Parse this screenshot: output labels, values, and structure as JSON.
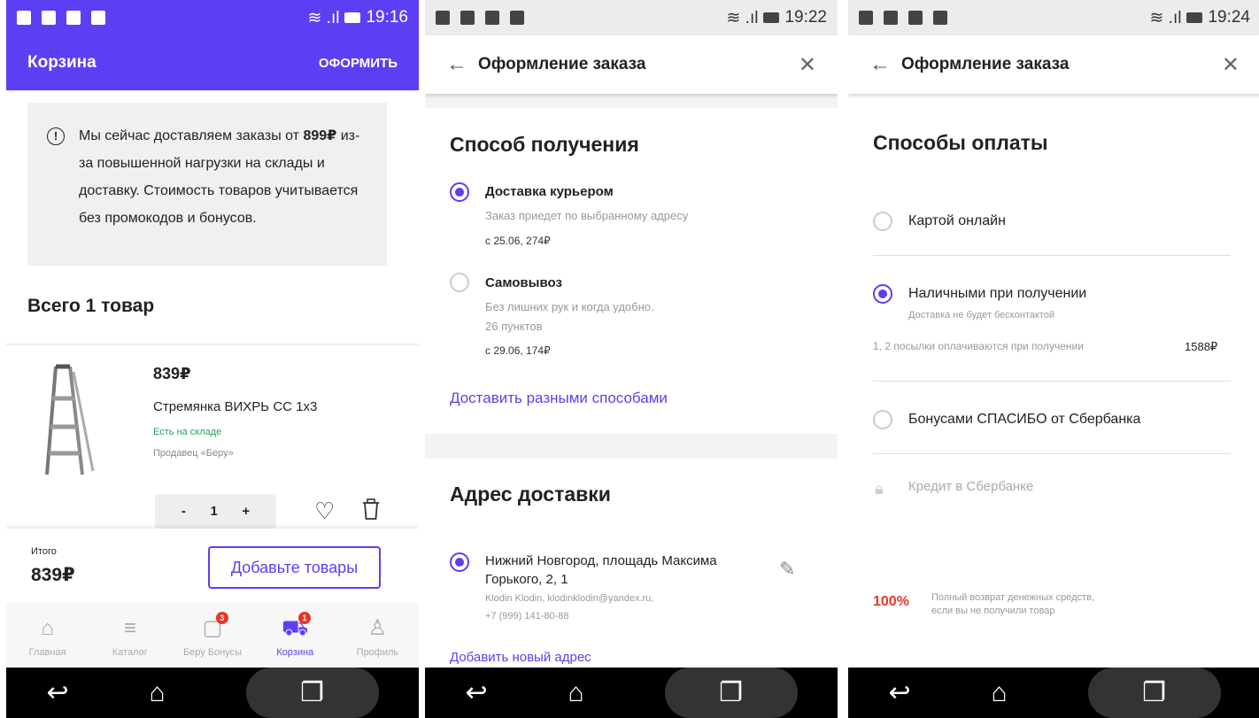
{
  "status_bars": [
    {
      "time": "19:16"
    },
    {
      "time": "19:22"
    },
    {
      "time": "19:24"
    }
  ],
  "cart": {
    "title": "Корзина",
    "action": "ОФОРМИТЬ",
    "notice_pre": "Мы сейчас доставляем заказы от ",
    "notice_bold": "899₽",
    "notice_post": " из-за повышенной нагрузки на склады и доставку. Стоимость товаров учитывается без промокодов и бонусов.",
    "count_title": "Всего 1 товар",
    "product": {
      "price": "839₽",
      "name": "Стремянка ВИХРЬ СС 1х3",
      "stock": "Есть на складе",
      "seller": "Продавец «Беру»",
      "qty_minus": "-",
      "qty": "1",
      "qty_plus": "+"
    },
    "total_label": "Итого",
    "total_sum": "839₽",
    "add_button": "Добавьте товары",
    "nav": [
      {
        "label": "Главная",
        "icon": "home-icon",
        "glyph": "⌂"
      },
      {
        "label": "Каталог",
        "icon": "catalog-search-icon",
        "glyph": "≡"
      },
      {
        "label": "Беру Бонусы",
        "icon": "bonus-gift-icon",
        "glyph": "▢",
        "badge": "3"
      },
      {
        "label": "Корзина",
        "icon": "cart-icon",
        "glyph": "⛟",
        "badge": "1",
        "active": true
      },
      {
        "label": "Профиль",
        "icon": "profile-icon",
        "glyph": "♙"
      }
    ]
  },
  "delivery": {
    "header_title": "Оформление заказа",
    "section_title": "Способ получения",
    "courier": {
      "title": "Доставка курьером",
      "desc": "Заказ приедет по выбранному адресу",
      "date": "с 25.06, 274₽"
    },
    "pickup": {
      "title": "Самовывоз",
      "desc1": "Без лишних рук и когда удобно.",
      "desc2": "26 пунктов",
      "date": "с 29.06, 174₽"
    },
    "split_link": "Доставить разными способами",
    "address_title": "Адрес доставки",
    "address_line1": "Нижний Новгород, площадь Максима",
    "address_line2": "Горького, 2, 1",
    "contact1": "Klodin Klodin, klodinklodin@yandex.ru,",
    "contact2": "+7 (999) 141-80-88",
    "add_address": "Добавить новый адрес"
  },
  "payment": {
    "header_title": "Оформление заказа",
    "section_title": "Способы оплаты",
    "card": "Картой онлайн",
    "cash": "Наличными при получении",
    "cash_note": "Доставка не будет бесконтактой",
    "parcels": "1, 2 посылки оплачиваются при получении",
    "parcels_sum": "1588₽",
    "bonus": "Бонусами СПАСИБО от Сбербанка",
    "credit": "Кредит в Сбербанке",
    "refund_pct": "100%",
    "refund_line1": "Полный возврат денежных средств,",
    "refund_line2": "если вы не получили товар"
  },
  "colors": {
    "accent": "#5e3ef2",
    "stock": "#21a35a",
    "badge": "#e5362b",
    "refund": "#e5362b"
  }
}
